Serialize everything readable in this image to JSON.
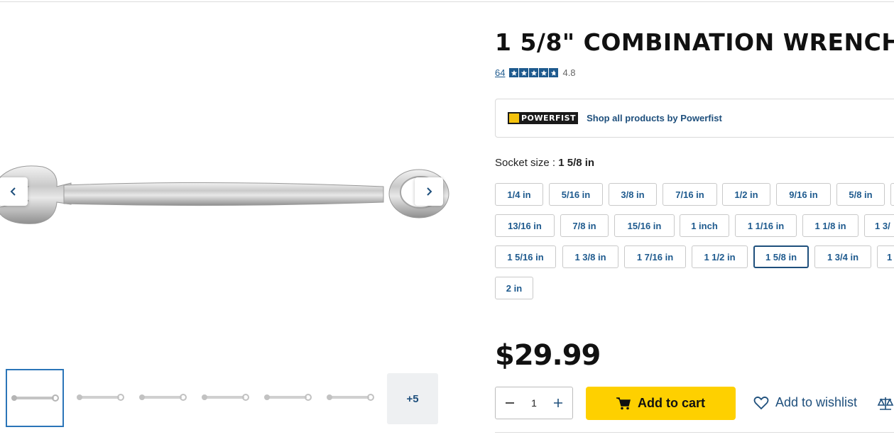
{
  "product": {
    "title": "1 5/8\" COMBINATION WRENCH",
    "review_count": "64",
    "rating": 4.8,
    "rating_text": "4.8",
    "stars": 5
  },
  "brand": {
    "logo_text": "POWERFIST",
    "shop_link": "Shop all products by Powerfist"
  },
  "socket": {
    "label": "Socket size :",
    "selected": "1 5/8 in",
    "options": [
      "1/4 in",
      "5/16 in",
      "3/8 in",
      "7/16 in",
      "1/2 in",
      "9/16 in",
      "5/8 in",
      "",
      "13/16 in",
      "7/8 in",
      "15/16 in",
      "1 inch",
      "1 1/16 in",
      "1 1/8 in",
      "1 3/",
      "1 5/16 in",
      "1 3/8 in",
      "1 7/16 in",
      "1 1/2 in",
      "1 5/8 in",
      "1 3/4 in",
      "1",
      "2 in"
    ]
  },
  "gallery": {
    "more_label": "+5",
    "thumbnail_count": 6
  },
  "purchase": {
    "price": "$29.99",
    "quantity": "1",
    "add_to_cart": "Add to cart",
    "add_to_wishlist": "Add to wishlist"
  },
  "colors": {
    "accent_blue": "#1e5a8e",
    "cart_yellow": "#fed000",
    "selected_border": "#1e4f7c"
  }
}
